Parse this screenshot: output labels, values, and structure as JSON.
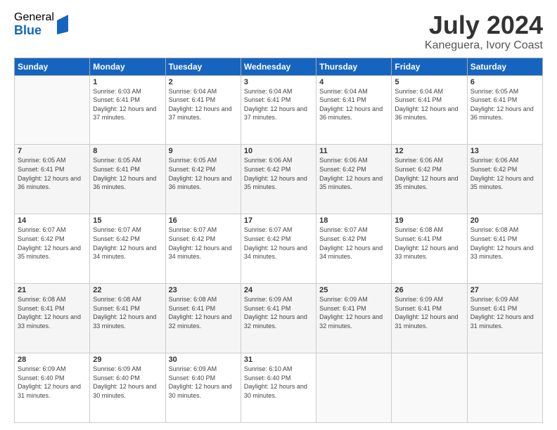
{
  "logo": {
    "general": "General",
    "blue": "Blue"
  },
  "title": {
    "month_year": "July 2024",
    "location": "Kaneguera, Ivory Coast"
  },
  "calendar": {
    "headers": [
      "Sunday",
      "Monday",
      "Tuesday",
      "Wednesday",
      "Thursday",
      "Friday",
      "Saturday"
    ],
    "weeks": [
      [
        {
          "day": "",
          "sunrise": "",
          "sunset": "",
          "daylight": ""
        },
        {
          "day": "1",
          "sunrise": "Sunrise: 6:03 AM",
          "sunset": "Sunset: 6:41 PM",
          "daylight": "Daylight: 12 hours and 37 minutes."
        },
        {
          "day": "2",
          "sunrise": "Sunrise: 6:04 AM",
          "sunset": "Sunset: 6:41 PM",
          "daylight": "Daylight: 12 hours and 37 minutes."
        },
        {
          "day": "3",
          "sunrise": "Sunrise: 6:04 AM",
          "sunset": "Sunset: 6:41 PM",
          "daylight": "Daylight: 12 hours and 37 minutes."
        },
        {
          "day": "4",
          "sunrise": "Sunrise: 6:04 AM",
          "sunset": "Sunset: 6:41 PM",
          "daylight": "Daylight: 12 hours and 36 minutes."
        },
        {
          "day": "5",
          "sunrise": "Sunrise: 6:04 AM",
          "sunset": "Sunset: 6:41 PM",
          "daylight": "Daylight: 12 hours and 36 minutes."
        },
        {
          "day": "6",
          "sunrise": "Sunrise: 6:05 AM",
          "sunset": "Sunset: 6:41 PM",
          "daylight": "Daylight: 12 hours and 36 minutes."
        }
      ],
      [
        {
          "day": "7",
          "sunrise": "Sunrise: 6:05 AM",
          "sunset": "Sunset: 6:41 PM",
          "daylight": "Daylight: 12 hours and 36 minutes."
        },
        {
          "day": "8",
          "sunrise": "Sunrise: 6:05 AM",
          "sunset": "Sunset: 6:41 PM",
          "daylight": "Daylight: 12 hours and 36 minutes."
        },
        {
          "day": "9",
          "sunrise": "Sunrise: 6:05 AM",
          "sunset": "Sunset: 6:42 PM",
          "daylight": "Daylight: 12 hours and 36 minutes."
        },
        {
          "day": "10",
          "sunrise": "Sunrise: 6:06 AM",
          "sunset": "Sunset: 6:42 PM",
          "daylight": "Daylight: 12 hours and 35 minutes."
        },
        {
          "day": "11",
          "sunrise": "Sunrise: 6:06 AM",
          "sunset": "Sunset: 6:42 PM",
          "daylight": "Daylight: 12 hours and 35 minutes."
        },
        {
          "day": "12",
          "sunrise": "Sunrise: 6:06 AM",
          "sunset": "Sunset: 6:42 PM",
          "daylight": "Daylight: 12 hours and 35 minutes."
        },
        {
          "day": "13",
          "sunrise": "Sunrise: 6:06 AM",
          "sunset": "Sunset: 6:42 PM",
          "daylight": "Daylight: 12 hours and 35 minutes."
        }
      ],
      [
        {
          "day": "14",
          "sunrise": "Sunrise: 6:07 AM",
          "sunset": "Sunset: 6:42 PM",
          "daylight": "Daylight: 12 hours and 35 minutes."
        },
        {
          "day": "15",
          "sunrise": "Sunrise: 6:07 AM",
          "sunset": "Sunset: 6:42 PM",
          "daylight": "Daylight: 12 hours and 34 minutes."
        },
        {
          "day": "16",
          "sunrise": "Sunrise: 6:07 AM",
          "sunset": "Sunset: 6:42 PM",
          "daylight": "Daylight: 12 hours and 34 minutes."
        },
        {
          "day": "17",
          "sunrise": "Sunrise: 6:07 AM",
          "sunset": "Sunset: 6:42 PM",
          "daylight": "Daylight: 12 hours and 34 minutes."
        },
        {
          "day": "18",
          "sunrise": "Sunrise: 6:07 AM",
          "sunset": "Sunset: 6:42 PM",
          "daylight": "Daylight: 12 hours and 34 minutes."
        },
        {
          "day": "19",
          "sunrise": "Sunrise: 6:08 AM",
          "sunset": "Sunset: 6:41 PM",
          "daylight": "Daylight: 12 hours and 33 minutes."
        },
        {
          "day": "20",
          "sunrise": "Sunrise: 6:08 AM",
          "sunset": "Sunset: 6:41 PM",
          "daylight": "Daylight: 12 hours and 33 minutes."
        }
      ],
      [
        {
          "day": "21",
          "sunrise": "Sunrise: 6:08 AM",
          "sunset": "Sunset: 6:41 PM",
          "daylight": "Daylight: 12 hours and 33 minutes."
        },
        {
          "day": "22",
          "sunrise": "Sunrise: 6:08 AM",
          "sunset": "Sunset: 6:41 PM",
          "daylight": "Daylight: 12 hours and 33 minutes."
        },
        {
          "day": "23",
          "sunrise": "Sunrise: 6:08 AM",
          "sunset": "Sunset: 6:41 PM",
          "daylight": "Daylight: 12 hours and 32 minutes."
        },
        {
          "day": "24",
          "sunrise": "Sunrise: 6:09 AM",
          "sunset": "Sunset: 6:41 PM",
          "daylight": "Daylight: 12 hours and 32 minutes."
        },
        {
          "day": "25",
          "sunrise": "Sunrise: 6:09 AM",
          "sunset": "Sunset: 6:41 PM",
          "daylight": "Daylight: 12 hours and 32 minutes."
        },
        {
          "day": "26",
          "sunrise": "Sunrise: 6:09 AM",
          "sunset": "Sunset: 6:41 PM",
          "daylight": "Daylight: 12 hours and 31 minutes."
        },
        {
          "day": "27",
          "sunrise": "Sunrise: 6:09 AM",
          "sunset": "Sunset: 6:41 PM",
          "daylight": "Daylight: 12 hours and 31 minutes."
        }
      ],
      [
        {
          "day": "28",
          "sunrise": "Sunrise: 6:09 AM",
          "sunset": "Sunset: 6:40 PM",
          "daylight": "Daylight: 12 hours and 31 minutes."
        },
        {
          "day": "29",
          "sunrise": "Sunrise: 6:09 AM",
          "sunset": "Sunset: 6:40 PM",
          "daylight": "Daylight: 12 hours and 30 minutes."
        },
        {
          "day": "30",
          "sunrise": "Sunrise: 6:09 AM",
          "sunset": "Sunset: 6:40 PM",
          "daylight": "Daylight: 12 hours and 30 minutes."
        },
        {
          "day": "31",
          "sunrise": "Sunrise: 6:10 AM",
          "sunset": "Sunset: 6:40 PM",
          "daylight": "Daylight: 12 hours and 30 minutes."
        },
        {
          "day": "",
          "sunrise": "",
          "sunset": "",
          "daylight": ""
        },
        {
          "day": "",
          "sunrise": "",
          "sunset": "",
          "daylight": ""
        },
        {
          "day": "",
          "sunrise": "",
          "sunset": "",
          "daylight": ""
        }
      ]
    ]
  }
}
